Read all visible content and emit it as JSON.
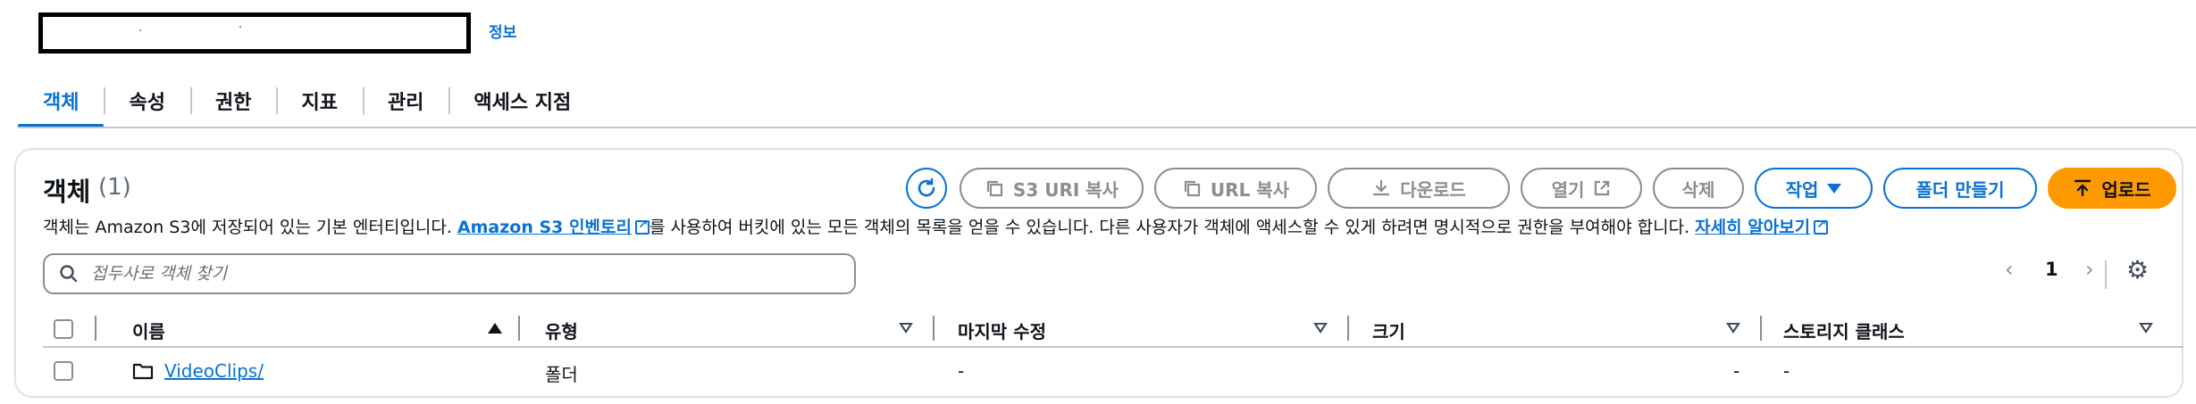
{
  "header": {
    "info_label": "정보"
  },
  "tabs": [
    {
      "label": "객체",
      "active": true
    },
    {
      "label": "속성"
    },
    {
      "label": "권한"
    },
    {
      "label": "지표"
    },
    {
      "label": "관리"
    },
    {
      "label": "액세스 지점"
    }
  ],
  "panel": {
    "title": "객체",
    "count": "(1)",
    "description_prefix": "객체는 Amazon S3에 저장되어 있는 기본 엔터티입니다. ",
    "inventory_link": "Amazon S3 인벤토리",
    "description_middle": "를 사용하여 버킷에 있는 모든 객체의 목록을 얻을 수 있습니다. 다른 사용자가 객체에 액세스할 수 있게 하려면 명시적으로 권한을 부여해야 합니다. ",
    "learn_more_link": "자세히 알아보기"
  },
  "toolbar": {
    "copy_s3_uri": "S3 URI 복사",
    "copy_url": "URL 복사",
    "download": "다운로드",
    "open": "열기",
    "delete": "삭제",
    "actions": "작업",
    "create_folder": "폴더 만들기",
    "upload": "업로드"
  },
  "search": {
    "placeholder": "접두사로 객체 찾기"
  },
  "pagination": {
    "current_page": "1"
  },
  "table": {
    "columns": [
      "이름",
      "유형",
      "마지막 수정",
      "크기",
      "스토리지 클래스"
    ],
    "rows": [
      {
        "name": "VideoClips/",
        "type": "폴더",
        "last_modified": "-",
        "size": "-",
        "storage_class": "-"
      }
    ]
  },
  "colors": {
    "accent": "#0972d3",
    "upload": "#ff9900",
    "border": "#c6c6cd",
    "disabled": "#8c8c94"
  }
}
